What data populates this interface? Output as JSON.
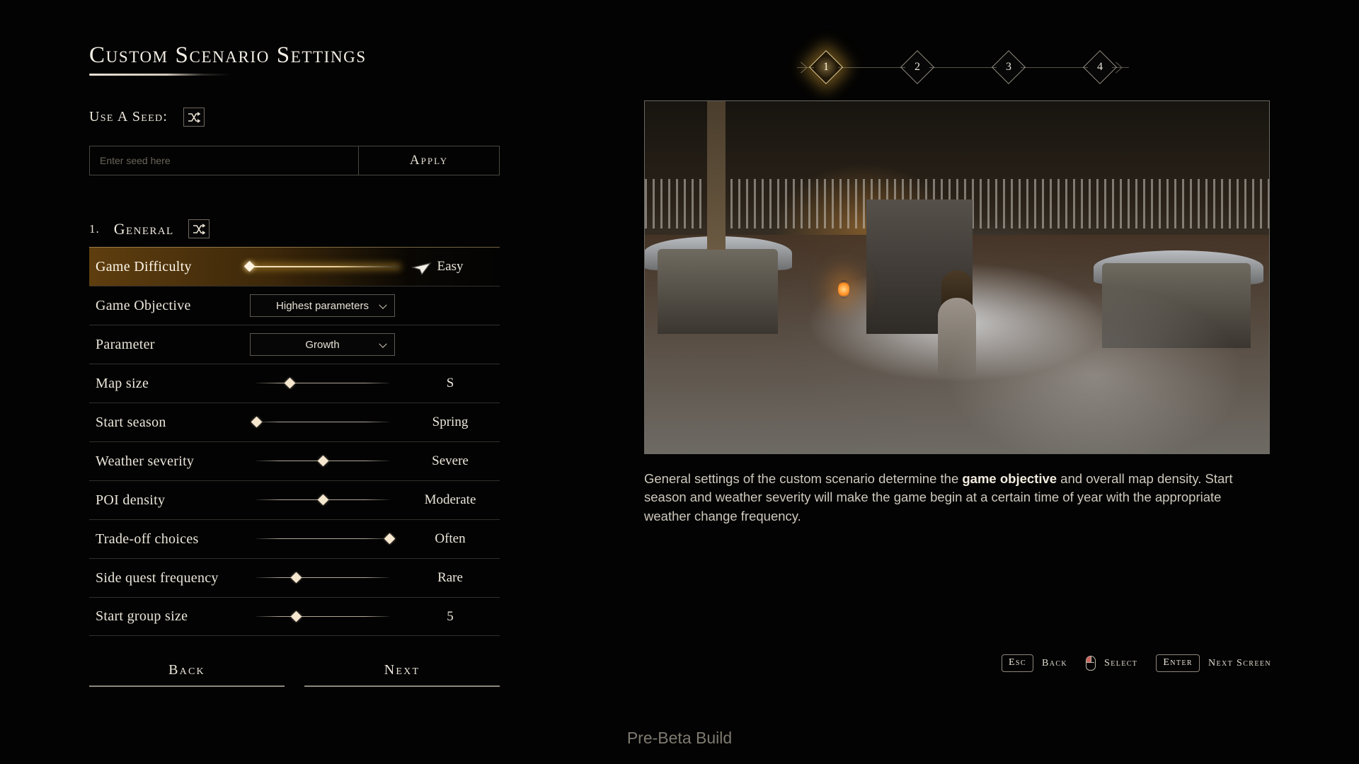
{
  "page_title": "Custom Scenario Settings",
  "seed": {
    "label": "Use a seed:",
    "randomize_icon": "shuffle-icon",
    "placeholder": "Enter seed here",
    "value": "",
    "apply_label": "Apply"
  },
  "section": {
    "number": "1.",
    "name": "General",
    "randomize_icon": "shuffle-icon"
  },
  "settings_rows": [
    {
      "label": "Game Difficulty",
      "control": "slider",
      "value": "Easy",
      "knob_pct": 2,
      "active": true
    },
    {
      "label": "Game Objective",
      "control": "dropdown",
      "value": "Highest parameters",
      "active": false
    },
    {
      "label": "Parameter",
      "control": "dropdown",
      "value": "Growth",
      "active": false
    },
    {
      "label": "Map size",
      "control": "slider",
      "value": "S",
      "knob_pct": 25,
      "active": false
    },
    {
      "label": "Start season",
      "control": "slider",
      "value": "Spring",
      "knob_pct": 0,
      "active": false
    },
    {
      "label": "Weather severity",
      "control": "slider",
      "value": "Severe",
      "knob_pct": 50,
      "active": false
    },
    {
      "label": "POI density",
      "control": "slider",
      "value": "Moderate",
      "knob_pct": 50,
      "active": false
    },
    {
      "label": "Trade-off choices",
      "control": "slider",
      "value": "Often",
      "knob_pct": 100,
      "active": false
    },
    {
      "label": "Side quest frequency",
      "control": "slider",
      "value": "Rare",
      "knob_pct": 30,
      "active": false
    },
    {
      "label": "Start group size",
      "control": "slider",
      "value": "5",
      "knob_pct": 30,
      "active": false
    }
  ],
  "footer_buttons": {
    "back": "Back",
    "next": "Next"
  },
  "steps": [
    {
      "label": "1",
      "current": true
    },
    {
      "label": "2",
      "current": false
    },
    {
      "label": "3",
      "current": false
    },
    {
      "label": "4",
      "current": false
    }
  ],
  "description": {
    "part1": "General settings of the custom scenario determine the ",
    "highlight": "game objective",
    "part2": " and overall map density. Start season and weather severity will make the game begin at a certain time of year with the appropriate weather change frequency."
  },
  "key_hints": [
    {
      "key": "Esc",
      "action": "Back",
      "icon": ""
    },
    {
      "key": "",
      "action": "Select",
      "icon": "mouse-icon"
    },
    {
      "key": "Enter",
      "action": "Next screen",
      "icon": ""
    }
  ],
  "build_tag": "Pre-Beta Build",
  "colors": {
    "accent": "#e0ac34",
    "text": "#ece6da",
    "muted": "#6a6459",
    "background": "#030303"
  }
}
